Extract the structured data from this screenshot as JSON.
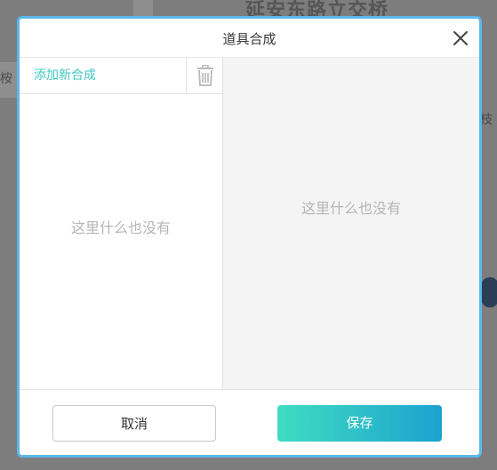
{
  "background": {
    "map_text": "延安东路立交桥",
    "side_text_left": "桉",
    "side_text_right": "枝"
  },
  "dialog": {
    "title": "道具合成",
    "close_icon": "close-icon",
    "left_pane": {
      "add_label": "添加新合成",
      "delete_icon": "trash-icon",
      "empty_text": "这里什么也没有"
    },
    "right_pane": {
      "empty_text": "这里什么也没有"
    },
    "footer": {
      "cancel_label": "取消",
      "save_label": "保存"
    }
  },
  "colors": {
    "accent": "#3ec8c0",
    "dialog_border": "#5bb7ea",
    "save_gradient_start": "#3fdcc1",
    "save_gradient_end": "#1ba2cf"
  }
}
